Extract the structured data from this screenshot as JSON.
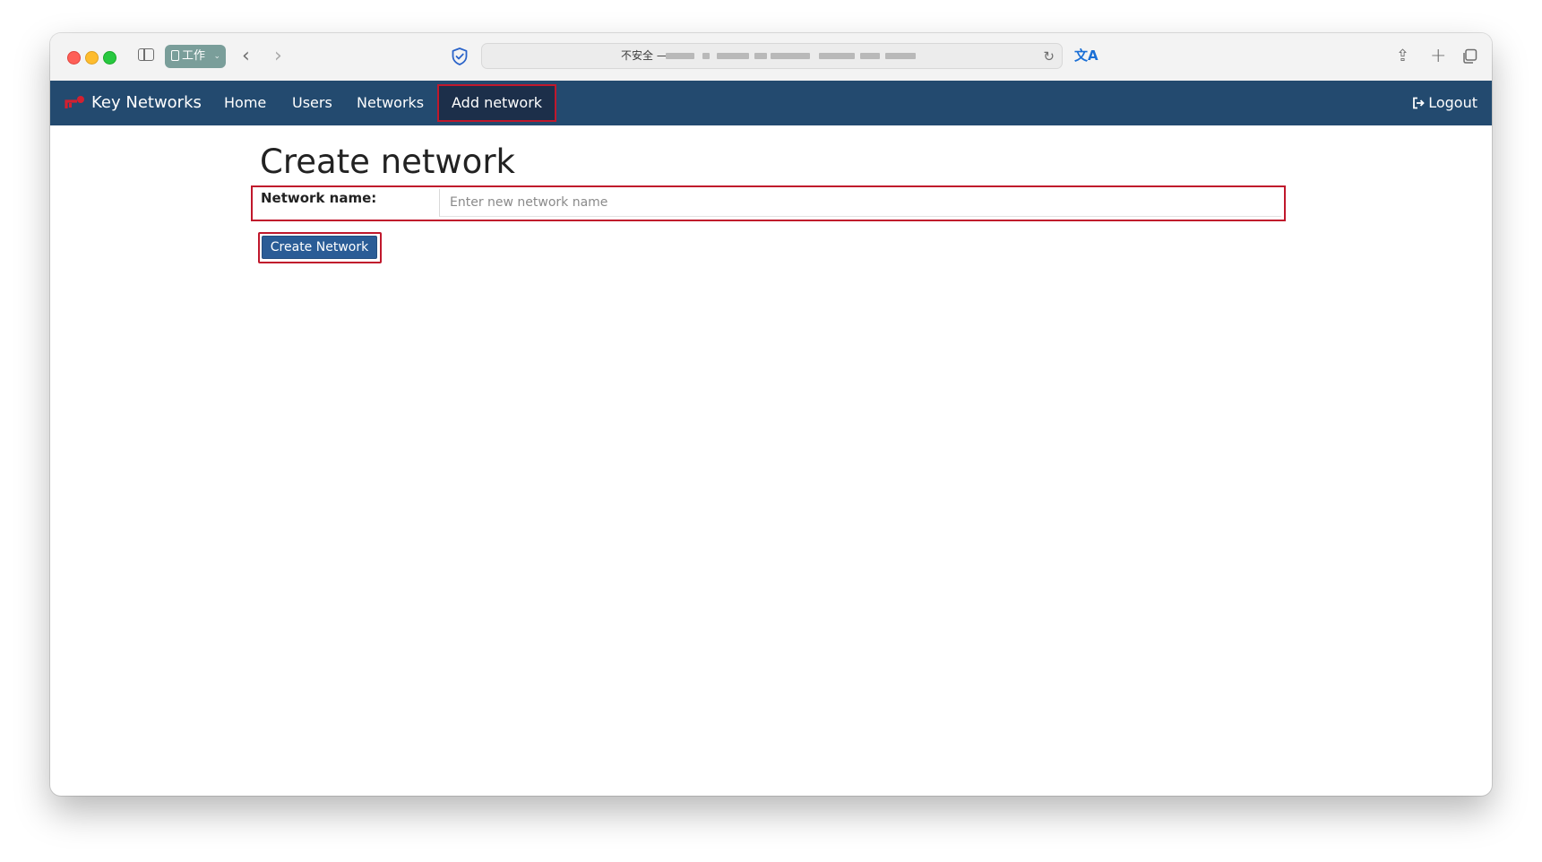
{
  "browser": {
    "profile_label": "工作",
    "url_prefix": "不安全 —",
    "icons": {
      "sidebar": "sidebar-toggle-icon",
      "back": "chevron-left-icon",
      "forward": "chevron-right-icon",
      "privacy": "shield-check-icon",
      "reload": "reload-icon",
      "translate": "translate-icon",
      "share": "share-icon",
      "new_tab": "plus-icon",
      "tab_overview": "tab-overview-icon"
    }
  },
  "navbar": {
    "brand": "Key Networks",
    "items": [
      {
        "label": "Home"
      },
      {
        "label": "Users"
      },
      {
        "label": "Networks"
      },
      {
        "label": "Add network",
        "active": true
      }
    ],
    "logout": "Logout",
    "colors": {
      "background": "#234a6f",
      "active_background": "#1c2f4a",
      "highlight": "#c0182c"
    }
  },
  "page": {
    "title": "Create network",
    "form": {
      "network_name_label": "Network name:",
      "network_name_value": "",
      "network_name_placeholder": "Enter new network name",
      "submit_label": "Create Network"
    }
  }
}
